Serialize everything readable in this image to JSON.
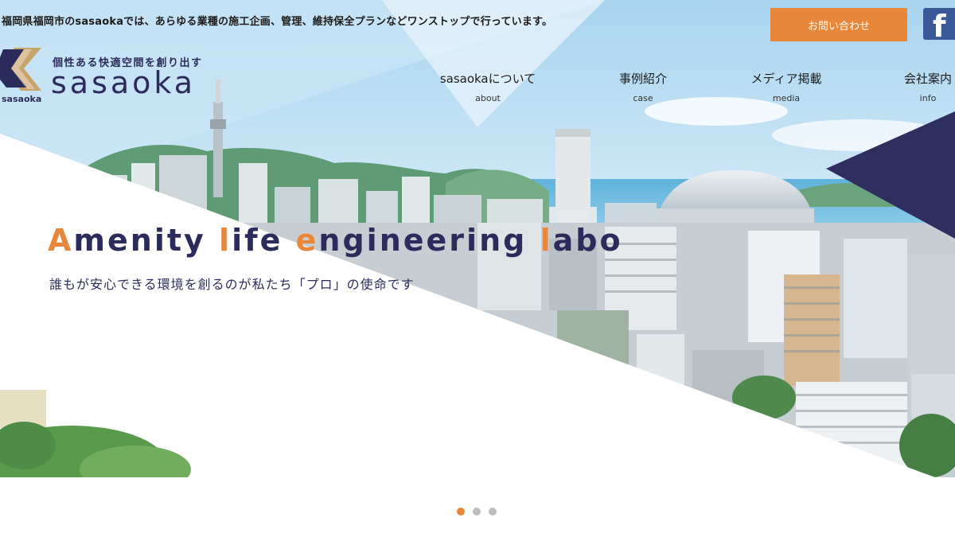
{
  "header": {
    "tagline": "福岡県福岡市のsasaokaでは、あらゆる業種の施工企画、管理、維持保全プランなどワンストップで行っています。",
    "contact_label": "お問い合わせ",
    "facebook_glyph": "f"
  },
  "logo": {
    "catchphrase": "個性ある快適空間を創り出す",
    "wordmark": "sasaoka",
    "small_text": "sasaoka"
  },
  "nav": {
    "items": [
      {
        "jp": "sasaokaについて",
        "en": "about"
      },
      {
        "jp": "事例紹介",
        "en": "case"
      },
      {
        "jp": "メディア掲載",
        "en": "media"
      },
      {
        "jp": "会社案内",
        "en": "info"
      }
    ]
  },
  "hero": {
    "headline": [
      {
        "accent": "A",
        "rest": "menity "
      },
      {
        "accent": "l",
        "rest": "ife "
      },
      {
        "accent": "e",
        "rest": "ngineering "
      },
      {
        "accent": "l",
        "rest": "abo"
      }
    ],
    "subline": "誰もが安心できる環境を創るのが私たち「プロ」の使命です"
  },
  "slider": {
    "count": 3,
    "active": 0
  },
  "colors": {
    "accent": "#e8873a",
    "navy": "#2c2c5c",
    "facebook": "#3b5998"
  }
}
